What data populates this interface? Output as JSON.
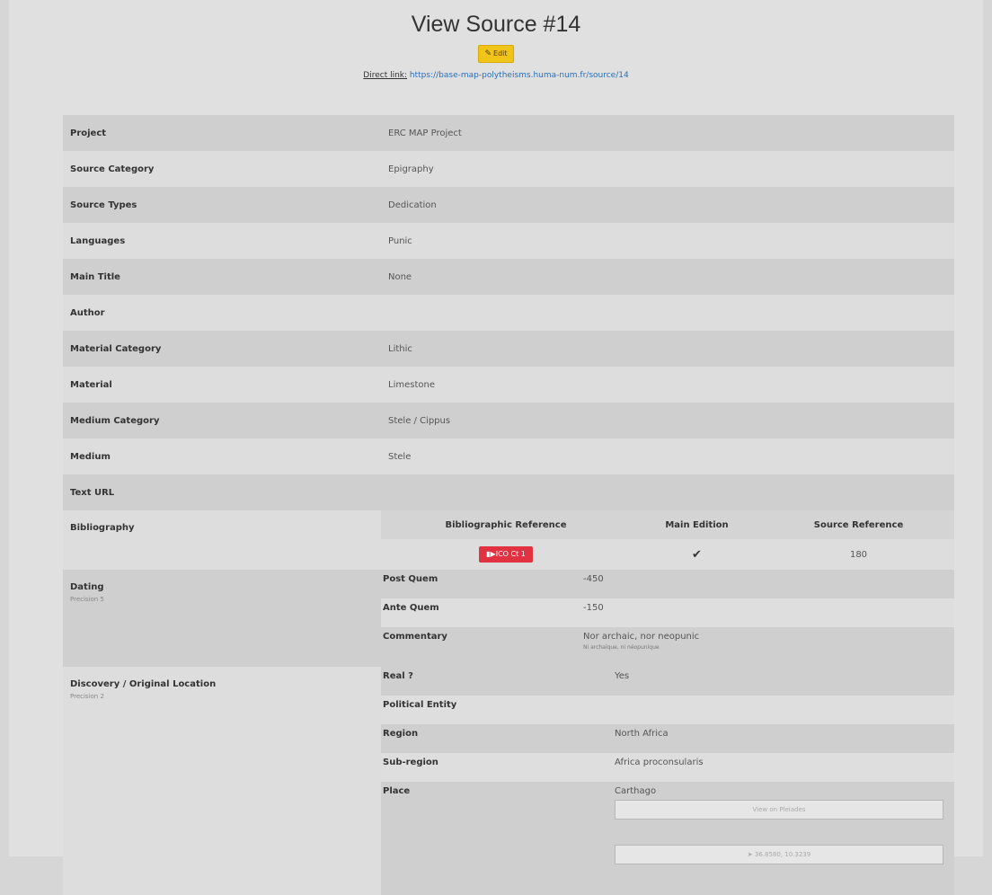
{
  "header": {
    "title": "View Source #14",
    "edit_label": "Edit",
    "direct_label": "Direct link:",
    "direct_url": "https://base-map-polytheisms.huma-num.fr/source/14"
  },
  "fields": [
    {
      "label": "Project",
      "value": "ERC MAP Project"
    },
    {
      "label": "Source Category",
      "value": "Epigraphy"
    },
    {
      "label": "Source Types",
      "value": "Dedication"
    },
    {
      "label": "Languages",
      "value": "Punic"
    },
    {
      "label": "Main Title",
      "value": "None"
    },
    {
      "label": "Author",
      "value": ""
    },
    {
      "label": "Material Category",
      "value": "Lithic"
    },
    {
      "label": "Material",
      "value": "Limestone"
    },
    {
      "label": "Medium Category",
      "value": "Stele / Cippus"
    },
    {
      "label": "Medium",
      "value": "Stele"
    },
    {
      "label": "Text URL",
      "value": ""
    }
  ],
  "bibliography": {
    "label": "Bibliography",
    "headers": [
      "Bibliographic Reference",
      "Main Edition",
      "Source Reference"
    ],
    "row": {
      "reference": "ICO Ct 1",
      "main_edition": "✔",
      "source_reference": "180"
    }
  },
  "dating": {
    "label": "Dating",
    "precision": "Precision 5",
    "rows": [
      {
        "key": "Post Quem",
        "value": "-450",
        "note": ""
      },
      {
        "key": "Ante Quem",
        "value": "-150",
        "note": ""
      },
      {
        "key": "Commentary",
        "value": "Nor archaic, nor neopunic",
        "note": "Ni archaïque, ni néopunique"
      }
    ]
  },
  "location": {
    "label": "Discovery / Original Location",
    "precision": "Precision 2",
    "rows": [
      {
        "key": "Real ?",
        "value": "Yes"
      },
      {
        "key": "Political Entity",
        "value": ""
      },
      {
        "key": "Region",
        "value": "North Africa"
      },
      {
        "key": "Sub-region",
        "value": "Africa proconsularis"
      },
      {
        "key": "Place",
        "value": "Carthago"
      }
    ],
    "pleiades_label": "View on Pleiades",
    "coords_label": "36.8580, 10.3239"
  }
}
